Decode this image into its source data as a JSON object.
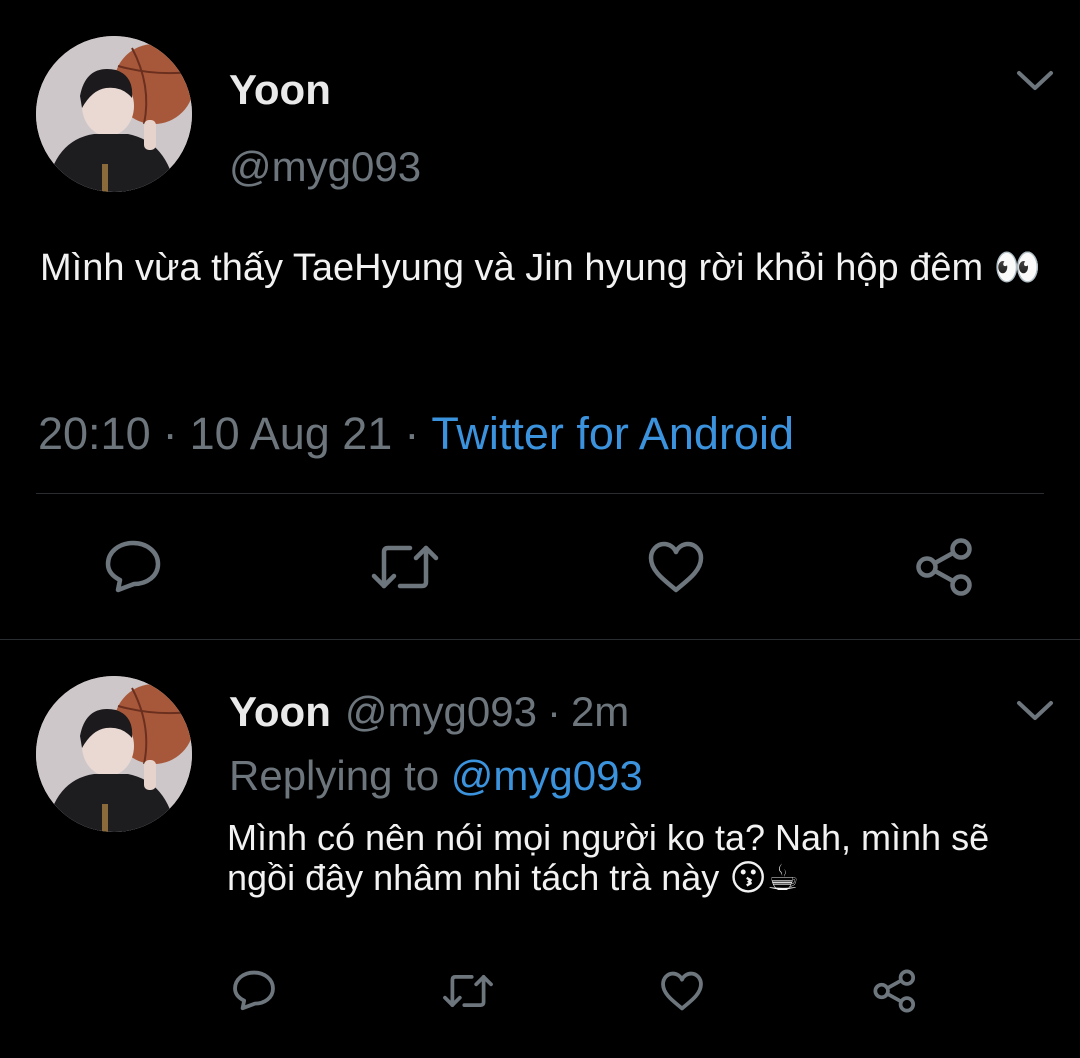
{
  "tweet": {
    "author_name": "Yoon",
    "author_handle": "@myg093",
    "text": "Mình vừa thấy TaeHyung và Jin hyung rời khỏi hộp đêm 👀",
    "time": "20:10",
    "date": "10 Aug 21",
    "separator": "·",
    "source": "Twitter for Android"
  },
  "reply": {
    "author_name": "Yoon",
    "author_handle": "@myg093",
    "separator": "·",
    "time_ago": "2m",
    "replying_label": "Replying to",
    "replying_target": "@myg093",
    "text": "Mình có nên nói mọi người ko ta? Nah, mình sẽ ngồi đây nhâm nhi tách trà này 😗☕"
  },
  "icons": {
    "reply": "reply-icon",
    "retweet": "retweet-icon",
    "like": "like-icon",
    "share": "share-icon",
    "more": "chevron-down-icon"
  },
  "colors": {
    "background": "#000000",
    "text": "#f2f2f2",
    "secondary": "#6e767d",
    "link": "#3c93dd",
    "divider": "#2a2d30"
  }
}
